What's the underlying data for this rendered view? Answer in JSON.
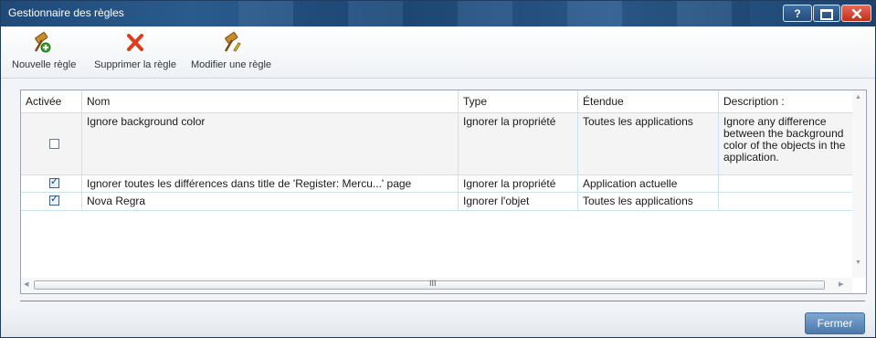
{
  "window": {
    "title": "Gestionnaire des règles",
    "help_label": "?"
  },
  "toolbar": {
    "new_rule_label": "Nouvelle règle",
    "delete_rule_label": "Supprimer la règle",
    "edit_rule_label": "Modifier une règle"
  },
  "table": {
    "columns": [
      "Activée",
      "Nom",
      "Type",
      "Étendue",
      "Description :"
    ],
    "rows": [
      {
        "enabled": false,
        "name": "Ignore background color",
        "type": "Ignorer la propriété",
        "scope": "Toutes les applications",
        "description": [
          "Ignore any difference",
          "between the background",
          "color of the objects in the",
          "application."
        ]
      },
      {
        "enabled": true,
        "name": "Ignorer toutes les différences dans title de 'Register: Mercu...' page",
        "type": "Ignorer la propriété",
        "scope": "Application actuelle",
        "description": []
      },
      {
        "enabled": true,
        "name": "Nova Regra",
        "type": "Ignorer l'objet",
        "scope": "Toutes les applications",
        "description": []
      }
    ],
    "scroll_grip": "III"
  },
  "footer": {
    "close_label": "Fermer"
  },
  "colors": {
    "titlebar": "#1f4a78",
    "close_button": "#c0301c",
    "accent": "#4a79aa"
  },
  "icons": [
    "gavel-add-icon",
    "delete-x-icon",
    "gavel-edit-icon"
  ]
}
